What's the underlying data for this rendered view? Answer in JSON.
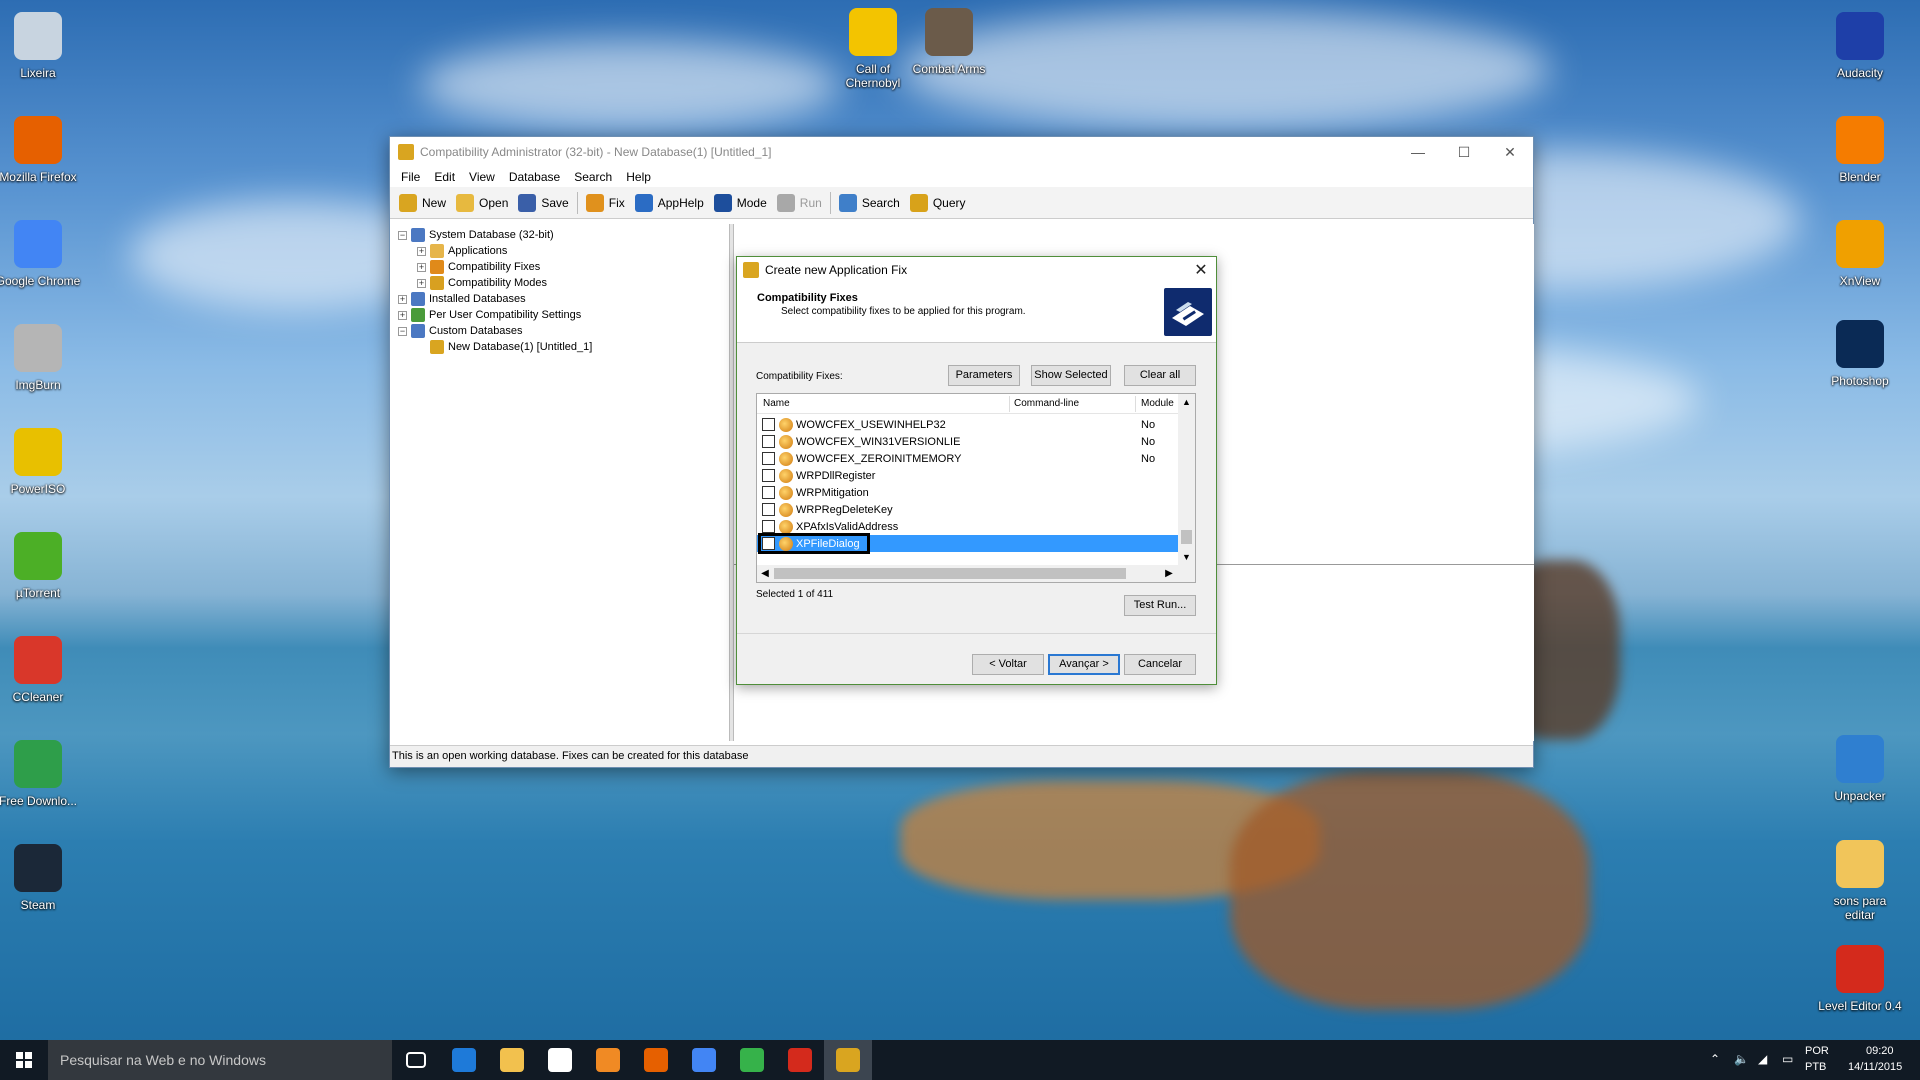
{
  "desktop": {
    "left_icons": [
      {
        "label": "Lixeira",
        "icon": "recycle-bin-icon",
        "color": "#c8d4e0"
      },
      {
        "label": "Mozilla Firefox",
        "icon": "firefox-icon",
        "color": "#e66000"
      },
      {
        "label": "Google Chrome",
        "icon": "chrome-icon",
        "color": "#4285f4"
      },
      {
        "label": "ImgBurn",
        "icon": "imgburn-icon",
        "color": "#b5b5b5"
      },
      {
        "label": "PowerISO",
        "icon": "poweriso-icon",
        "color": "#e8c000"
      },
      {
        "label": "µTorrent",
        "icon": "utorrent-icon",
        "color": "#4caf26"
      },
      {
        "label": "CCleaner",
        "icon": "ccleaner-icon",
        "color": "#d9372a"
      },
      {
        "label": "Free Downlo...",
        "icon": "free-download-icon",
        "color": "#2e9e4a"
      },
      {
        "label": "Steam",
        "icon": "steam-icon",
        "color": "#1b2838"
      }
    ],
    "top_icons": [
      {
        "label": "Call of Chernobyl",
        "icon": "radiation-icon",
        "color": "#f3c400"
      },
      {
        "label": "Combat Arms",
        "icon": "combat-arms-icon",
        "color": "#6b5b4a"
      }
    ],
    "right_icons": [
      {
        "label": "Audacity",
        "icon": "audacity-icon",
        "color": "#1e3fa8"
      },
      {
        "label": "Blender",
        "icon": "blender-icon",
        "color": "#f57c00"
      },
      {
        "label": "XnView",
        "icon": "xnview-icon",
        "color": "#f0a000"
      },
      {
        "label": "Photoshop",
        "icon": "photoshop-icon",
        "color": "#0a2a55"
      },
      {
        "label": "Unpacker",
        "icon": "unpacker-icon",
        "color": "#2f7fd0"
      },
      {
        "label": "sons para editar",
        "icon": "folder-icon",
        "color": "#f1c55a"
      },
      {
        "label": "Level Editor 0.4",
        "icon": "level-editor-icon",
        "color": "#d42a1c"
      }
    ]
  },
  "window": {
    "title": "Compatibility Administrator (32-bit) - New Database(1) [Untitled_1]",
    "menu": [
      "File",
      "Edit",
      "View",
      "Database",
      "Search",
      "Help"
    ],
    "toolbar": [
      {
        "label": "New",
        "icon": "new-db-icon",
        "color": "#d9a520",
        "disabled": false
      },
      {
        "label": "Open",
        "icon": "open-folder-icon",
        "color": "#e7b93f",
        "disabled": false
      },
      {
        "label": "Save",
        "icon": "save-disk-icon",
        "color": "#3a5fa8",
        "disabled": false
      },
      {
        "label": "Fix",
        "icon": "fix-gear-icon",
        "color": "#e0911d",
        "disabled": false
      },
      {
        "label": "AppHelp",
        "icon": "apphelp-icon",
        "color": "#2b6cc4",
        "disabled": false
      },
      {
        "label": "Mode",
        "icon": "mode-icon",
        "color": "#1d4e9c",
        "disabled": false
      },
      {
        "label": "Run",
        "icon": "run-icon",
        "color": "#a8a8a8",
        "disabled": true
      },
      {
        "label": "Search",
        "icon": "search-icon",
        "color": "#3f7fc9",
        "disabled": false
      },
      {
        "label": "Query",
        "icon": "query-icon",
        "color": "#d8a21a",
        "disabled": false
      }
    ],
    "tree": [
      {
        "label": "System Database (32-bit)",
        "level": 0,
        "expander": "−",
        "icon": "system-db-icon",
        "color": "#4b78c2"
      },
      {
        "label": "Applications",
        "level": 1,
        "expander": "+",
        "icon": "applications-icon",
        "color": "#e6b54a"
      },
      {
        "label": "Compatibility Fixes",
        "level": 1,
        "expander": "+",
        "icon": "compat-fixes-icon",
        "color": "#e08a1a"
      },
      {
        "label": "Compatibility Modes",
        "level": 1,
        "expander": "+",
        "icon": "compat-modes-icon",
        "color": "#d8a020"
      },
      {
        "label": "Installed Databases",
        "level": 0,
        "expander": "+",
        "icon": "installed-db-icon",
        "color": "#4b78c2"
      },
      {
        "label": "Per User Compatibility Settings",
        "level": 0,
        "expander": "+",
        "icon": "per-user-icon",
        "color": "#4a9b3a"
      },
      {
        "label": "Custom Databases",
        "level": 0,
        "expander": "−",
        "icon": "custom-db-icon",
        "color": "#4b78c2"
      },
      {
        "label": "New Database(1) [Untitled_1]",
        "level": 1,
        "expander": "",
        "icon": "database-icon",
        "color": "#d9a520"
      }
    ],
    "status": "This is an open working database. Fixes can be created for this database"
  },
  "dialog": {
    "title": "Create new Application Fix",
    "header_title": "Compatibility Fixes",
    "header_subtitle": "Select compatibility fixes to be applied for this program.",
    "fixes_label": "Compatibility Fixes:",
    "parameters_btn": "Parameters",
    "show_selected_btn": "Show Selected",
    "clear_all_btn": "Clear all",
    "columns": {
      "name": "Name",
      "cmdline": "Command-line",
      "module": "Module"
    },
    "rows": [
      {
        "name": "WOWCFEX_USEWINHELP32",
        "module": "No",
        "checked": false,
        "selected": false
      },
      {
        "name": "WOWCFEX_WIN31VERSIONLIE",
        "module": "No",
        "checked": false,
        "selected": false
      },
      {
        "name": "WOWCFEX_ZEROINITMEMORY",
        "module": "No",
        "checked": false,
        "selected": false
      },
      {
        "name": "WRPDllRegister",
        "module": "",
        "checked": false,
        "selected": false
      },
      {
        "name": "WRPMitigation",
        "module": "",
        "checked": false,
        "selected": false
      },
      {
        "name": "WRPRegDeleteKey",
        "module": "",
        "checked": false,
        "selected": false
      },
      {
        "name": "XPAfxIsValidAddress",
        "module": "",
        "checked": false,
        "selected": false
      },
      {
        "name": "XPFileDialog",
        "module": "",
        "checked": true,
        "selected": true
      }
    ],
    "selected_count": "Selected 1 of 411",
    "test_run_btn": "Test Run...",
    "back_btn": "< Voltar",
    "next_btn": "Avançar >",
    "cancel_btn": "Cancelar"
  },
  "taskbar": {
    "search_placeholder": "Pesquisar na Web e no Windows",
    "apps": [
      {
        "name": "task-view-icon",
        "color": "#ffffff"
      },
      {
        "name": "edge-icon",
        "color": "#1e7ad9"
      },
      {
        "name": "file-explorer-icon",
        "color": "#f2c14e"
      },
      {
        "name": "store-icon",
        "color": "#ffffff"
      },
      {
        "name": "media-player-icon",
        "color": "#f08a24"
      },
      {
        "name": "firefox-icon",
        "color": "#e66000"
      },
      {
        "name": "chrome-icon",
        "color": "#4285f4"
      },
      {
        "name": "icq-icon",
        "color": "#36b24a"
      },
      {
        "name": "level-editor-icon",
        "color": "#d42a1c"
      },
      {
        "name": "compat-admin-icon",
        "color": "#d9a520"
      }
    ],
    "lang1": "POR",
    "lang2": "PTB",
    "time": "09:20",
    "date": "14/11/2015"
  }
}
